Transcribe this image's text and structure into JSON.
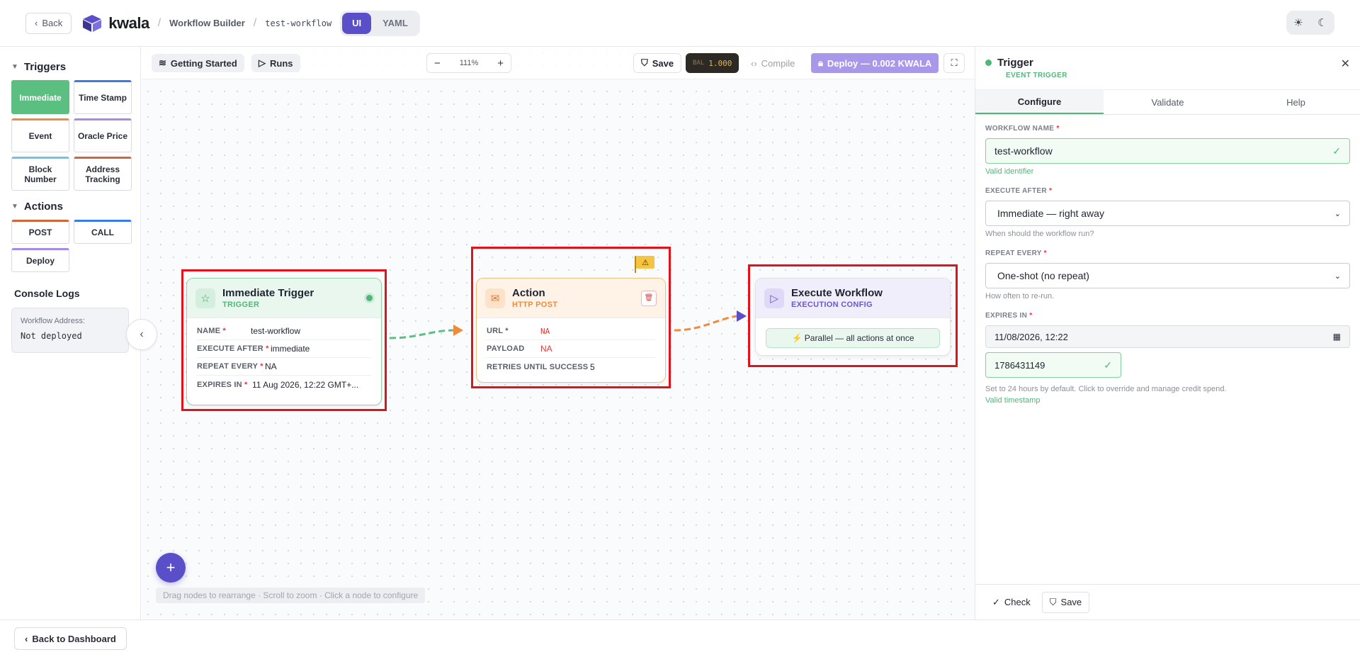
{
  "header": {
    "back_label": "Back",
    "logo_text": "kwala",
    "crumb_builder": "Workflow Builder",
    "crumb_workflow": "test-workflow",
    "mode_ui": "UI",
    "mode_yaml": "YAML"
  },
  "sidebar": {
    "triggers_title": "Triggers",
    "triggers": [
      {
        "label": "Immediate"
      },
      {
        "label": "Time Stamp"
      },
      {
        "label": "Event"
      },
      {
        "label": "Oracle Price"
      },
      {
        "label": "Block Number"
      },
      {
        "label": "Address Tracking"
      }
    ],
    "actions_title": "Actions",
    "actions": [
      {
        "label": "POST"
      },
      {
        "label": "CALL"
      },
      {
        "label": "Deploy"
      }
    ],
    "console_title": "Console Logs",
    "console_label": "Workflow Address:",
    "console_value": "Not deployed"
  },
  "toolbar": {
    "getting_started": "Getting Started",
    "runs": "Runs",
    "zoom": "111%",
    "save": "Save",
    "bal_label": "BAL",
    "bal_value": "1.000",
    "compile": "Compile",
    "deploy": "Deploy — 0.002 KWALA"
  },
  "nodes": {
    "trigger": {
      "title": "Immediate Trigger",
      "subtitle": "TRIGGER",
      "rows": [
        {
          "key": "NAME",
          "value": "test-workflow"
        },
        {
          "key": "EXECUTE AFTER",
          "value": "immediate"
        },
        {
          "key": "REPEAT EVERY",
          "value": "NA"
        },
        {
          "key": "EXPIRES IN",
          "value": "11 Aug 2026, 12:22 GMT+..."
        }
      ]
    },
    "action": {
      "title": "Action",
      "subtitle": "HTTP POST",
      "rows": [
        {
          "key": "URL",
          "value": "NA"
        },
        {
          "key": "PAYLOAD",
          "value": "NA"
        },
        {
          "key": "RETRIES UNTIL SUCCESS",
          "value": "5"
        }
      ]
    },
    "execute": {
      "title": "Execute Workflow",
      "subtitle": "EXECUTION CONFIG",
      "mode": "⚡ Parallel — all actions at once"
    }
  },
  "canvas": {
    "hint": "Drag nodes to rearrange · Scroll to zoom · Click a node to configure"
  },
  "panel": {
    "title": "Trigger",
    "subtitle": "EVENT TRIGGER",
    "tabs": [
      "Configure",
      "Validate",
      "Help"
    ],
    "workflow_name_label": "WORKFLOW NAME",
    "workflow_name_value": "test-workflow",
    "workflow_name_ok": "Valid identifier",
    "execute_after_label": "EXECUTE AFTER",
    "execute_after_value": "Immediate — right away",
    "execute_after_help": "When should the workflow run?",
    "repeat_label": "REPEAT EVERY",
    "repeat_value": "One-shot (no repeat)",
    "repeat_help": "How often to re-run.",
    "expires_label": "EXPIRES IN",
    "expires_value": "11/08/2026, 12:22",
    "timestamp_value": "1786431149",
    "expires_help": "Set to 24 hours by default. Click to override and manage credit spend.",
    "timestamp_ok": "Valid timestamp",
    "check_label": "Check",
    "save_label": "Save"
  },
  "footer": {
    "back_dashboard": "Back to Dashboard"
  },
  "colors": {
    "accent": "#5b4fc9",
    "trigger_green": "#4fb878",
    "action_orange": "#f08a3c",
    "execute_purple": "#6a56d1",
    "highlight_red": "#e3111a"
  }
}
